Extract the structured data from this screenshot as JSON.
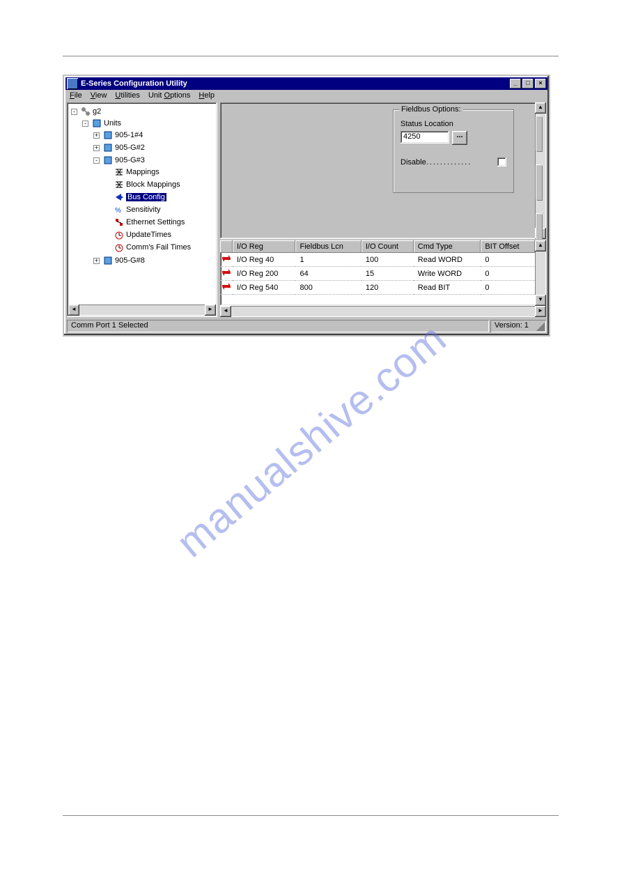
{
  "window": {
    "title": "E-Series Configuration Utility"
  },
  "menus": {
    "file": "File",
    "view": "View",
    "utilities": "Utilities",
    "unit_options": "Unit Options",
    "help": "Help"
  },
  "tree": {
    "root": "g2",
    "units_label": "Units",
    "nodes": {
      "n0": "905-1#4",
      "n1": "905-G#2",
      "n2": "905-G#3",
      "n3": "905-G#8"
    },
    "children": {
      "mappings": "Mappings",
      "block_mappings": "Block Mappings",
      "bus_config": "Bus Config",
      "sensitivity": "Sensitivity",
      "ethernet": "Ethernet Settings",
      "update": "UpdateTimes",
      "comms_fail": "Comm's Fail Times"
    }
  },
  "fieldbus": {
    "group_label": "Fieldbus Options:",
    "status_label": "Status Location",
    "status_value": "4250",
    "dots_btn": "...",
    "disable_label": "Disable"
  },
  "table": {
    "headers": {
      "ioreg": "I/O Reg",
      "lcn": "Fieldbus Lcn",
      "count": "I/O Count",
      "cmd": "Cmd Type",
      "bit": "BIT Offset"
    },
    "rows": [
      {
        "ioreg": "I/O Reg 40",
        "lcn": "1",
        "count": "100",
        "cmd": "Read WORD",
        "bit": "0"
      },
      {
        "ioreg": "I/O Reg 200",
        "lcn": "64",
        "count": "15",
        "cmd": "Write WORD",
        "bit": "0"
      },
      {
        "ioreg": "I/O Reg 540",
        "lcn": "800",
        "count": "120",
        "cmd": "Read BIT",
        "bit": "0"
      }
    ]
  },
  "statusbar": {
    "left": "Comm Port 1 Selected",
    "right": "Version: 1"
  },
  "watermark": "manualshive.com"
}
